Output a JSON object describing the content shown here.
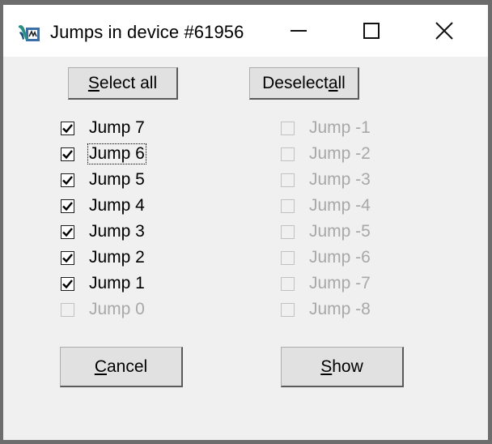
{
  "window": {
    "title": "Jumps in device #61956",
    "icon": "wavy-signal-app-icon",
    "controls": {
      "minimize": "minimize-icon",
      "maximize": "maximize-icon",
      "close": "close-icon"
    }
  },
  "buttons": {
    "select_all": {
      "pre": "",
      "key": "S",
      "post": "elect all"
    },
    "deselect_all": {
      "pre": "Deselect ",
      "key": "a",
      "post": "ll"
    },
    "cancel": {
      "pre": "",
      "key": "C",
      "post": "ancel"
    },
    "show": {
      "pre": "",
      "key": "S",
      "post": "how"
    }
  },
  "left_jumps": [
    {
      "label": "Jump 7",
      "checked": true,
      "enabled": true,
      "focused": false
    },
    {
      "label": "Jump 6",
      "checked": true,
      "enabled": true,
      "focused": true
    },
    {
      "label": "Jump 5",
      "checked": true,
      "enabled": true,
      "focused": false
    },
    {
      "label": "Jump 4",
      "checked": true,
      "enabled": true,
      "focused": false
    },
    {
      "label": "Jump 3",
      "checked": true,
      "enabled": true,
      "focused": false
    },
    {
      "label": "Jump 2",
      "checked": true,
      "enabled": true,
      "focused": false
    },
    {
      "label": "Jump 1",
      "checked": true,
      "enabled": true,
      "focused": false
    },
    {
      "label": "Jump 0",
      "checked": false,
      "enabled": false,
      "focused": false
    }
  ],
  "right_jumps": [
    {
      "label": "Jump -1",
      "checked": false,
      "enabled": false,
      "focused": false
    },
    {
      "label": "Jump -2",
      "checked": false,
      "enabled": false,
      "focused": false
    },
    {
      "label": "Jump -3",
      "checked": false,
      "enabled": false,
      "focused": false
    },
    {
      "label": "Jump -4",
      "checked": false,
      "enabled": false,
      "focused": false
    },
    {
      "label": "Jump -5",
      "checked": false,
      "enabled": false,
      "focused": false
    },
    {
      "label": "Jump -6",
      "checked": false,
      "enabled": false,
      "focused": false
    },
    {
      "label": "Jump -7",
      "checked": false,
      "enabled": false,
      "focused": false
    },
    {
      "label": "Jump -8",
      "checked": false,
      "enabled": false,
      "focused": false
    }
  ],
  "colors": {
    "dialog_bg": "#f0f0f0",
    "titlebar_bg": "#ffffff",
    "button_face": "#e1e1e1",
    "disabled_text": "#a8a8a8",
    "frame": "#6d6d6d"
  }
}
